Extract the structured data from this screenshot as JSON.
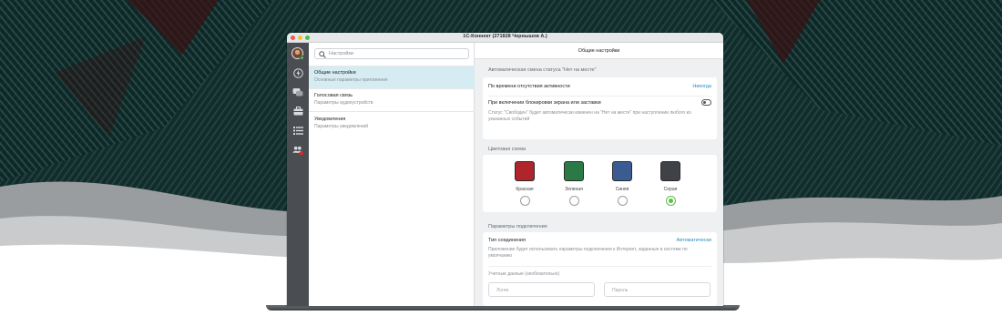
{
  "window": {
    "title": "1С-Коннект (271828 Чернышов А.)"
  },
  "search": {
    "placeholder": "Настройки"
  },
  "settings_list": [
    {
      "title": "Общие настройки",
      "subtitle": "Основные параметры приложения",
      "active": true
    },
    {
      "title": "Голосовая связь",
      "subtitle": "Параметры аудиоустройств",
      "active": false
    },
    {
      "title": "Уведомления",
      "subtitle": "Параметры уведомлений",
      "active": false
    }
  ],
  "rail_icons": [
    "avatar",
    "bolt-icon",
    "chat-icon",
    "briefcase-icon",
    "list-icon",
    "group-icon"
  ],
  "content": {
    "header": "Общие настройки",
    "away_section": {
      "label": "Автоматическая смена статуса \"Нет на месте\"",
      "idle_label": "По времени отсутствия активности",
      "idle_value": "Никогда",
      "lock_label": "При включении блокировки экрана или заставки",
      "lock_enabled": false,
      "desc": "Статус \"Свободен\" будет автоматически изменен на \"Нет на месте\" при наступлении любого из указанных событий"
    },
    "color_section": {
      "label": "Цветовая схема",
      "options": [
        {
          "name": "Красная",
          "color": "#b0242b",
          "selected": false
        },
        {
          "name": "Зеленая",
          "color": "#2b7a45",
          "selected": false
        },
        {
          "name": "Синяя",
          "color": "#3b5c91",
          "selected": false
        },
        {
          "name": "Серая",
          "color": "#3f4348",
          "selected": true
        }
      ]
    },
    "connection_section": {
      "label": "Параметры подключения",
      "type_label": "Тип соединения",
      "type_value": "Автоматически",
      "desc": "Приложение будет использовать параметры подключения к Интернет, заданные в системе по умолчанию",
      "credentials_label": "Учетные данные (необязательно)",
      "login_placeholder": "Логин",
      "password_placeholder": "Пароль"
    }
  },
  "colors": {
    "accent": "#2a8ec4",
    "active_item": "#d6ecf3",
    "arrow": "#e3262a",
    "rail": "#4a4d52"
  }
}
